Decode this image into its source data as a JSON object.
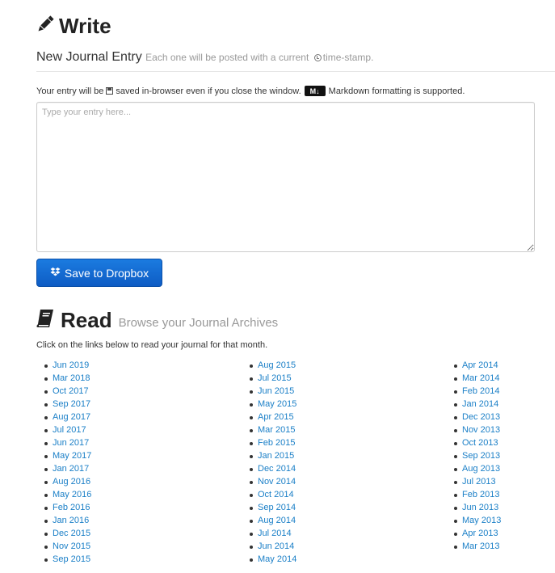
{
  "write": {
    "title": "Write",
    "icon": "pencil-icon",
    "subtitle": "New Journal Entry",
    "subtitle_note_prefix": "Each one will be posted with a current",
    "subtitle_note_suffix": "time-stamp."
  },
  "info": {
    "prefix": "Your entry will be",
    "middle": "saved in-browser even if you close the window.",
    "md_badge": "M↓",
    "suffix": "Markdown formatting is supported."
  },
  "entry": {
    "placeholder": "Type your entry here...",
    "value": ""
  },
  "save_button": {
    "label": "Save to Dropbox",
    "icon": "dropbox-icon",
    "color": "#0e5cc4"
  },
  "read": {
    "title": "Read",
    "icon": "book-icon",
    "subtitle": "Browse your Journal Archives",
    "instructions": "Click on the links below to read your journal for that month."
  },
  "archives": {
    "col1": [
      "Jun 2019",
      "Mar 2018",
      "Oct 2017",
      "Sep 2017",
      "Aug 2017",
      "Jul 2017",
      "Jun 2017",
      "May 2017",
      "Jan 2017",
      "Aug 2016",
      "May 2016",
      "Feb 2016",
      "Jan 2016",
      "Dec 2015",
      "Nov 2015",
      "Sep 2015"
    ],
    "col2": [
      "Aug 2015",
      "Jul 2015",
      "Jun 2015",
      "May 2015",
      "Apr 2015",
      "Mar 2015",
      "Feb 2015",
      "Jan 2015",
      "Dec 2014",
      "Nov 2014",
      "Oct 2014",
      "Sep 2014",
      "Aug 2014",
      "Jul 2014",
      "Jun 2014",
      "May 2014"
    ],
    "col3": [
      "Apr 2014",
      "Mar 2014",
      "Feb 2014",
      "Jan 2014",
      "Dec 2013",
      "Nov 2013",
      "Oct 2013",
      "Sep 2013",
      "Aug 2013",
      "Jul 2013",
      "Feb 2013",
      "Jun 2013",
      "May 2013",
      "Apr 2013",
      "Mar 2013"
    ]
  },
  "colors": {
    "link": "#1a7fc7",
    "muted": "#999999"
  }
}
